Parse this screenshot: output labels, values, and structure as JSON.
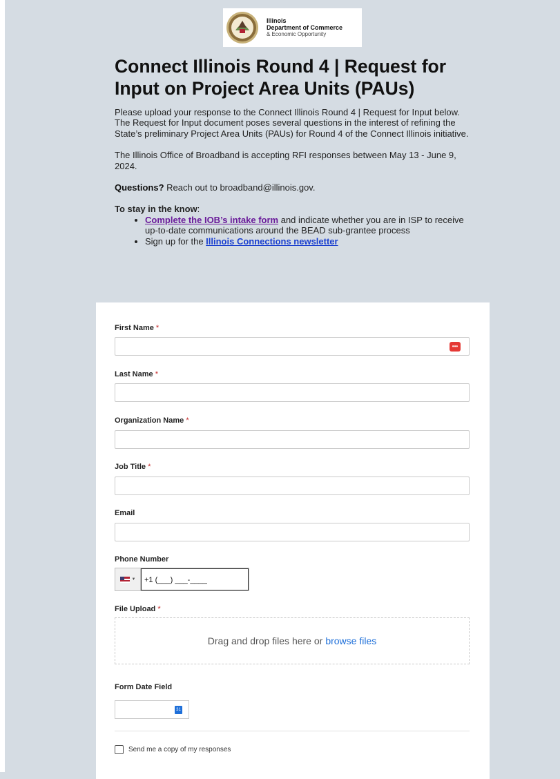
{
  "logo": {
    "line1": "Illinois",
    "line2": "Department of Commerce",
    "line3": "& Economic Opportunity"
  },
  "page": {
    "title": "Connect Illinois Round 4 | Request for Input on Project Area Units (PAUs)",
    "intro_p1": "Please upload your response to the Connect Illinois Round 4 | Request for Input below. The Request for Input document poses several questions in the interest of refining the State’s preliminary Project Area Units (PAUs) for Round 4 of the Connect Illinois initiative.",
    "intro_p2": "The Illinois Office of Broadband is accepting RFI responses between May 13 - June 9, 2024.",
    "questions_bold": "Questions?",
    "questions_text": " Reach out to broadband@illinois.gov.",
    "know_heading": "To stay in the know",
    "know_colon": ":",
    "bullet1_link": "Complete the IOB’s intake form",
    "bullet1_text": " and indicate whether you are in ISP to receive up-to-date communications around the BEAD sub-grantee process",
    "bullet2_text": "Sign up for the ",
    "bullet2_link": "Illinois Connections newsletter"
  },
  "form": {
    "required_mark": "*",
    "first_name_label": "First Name",
    "last_name_label": "Last Name",
    "organization_label": "Organization Name",
    "job_title_label": "Job Title",
    "email_label": "Email",
    "phone_label": "Phone Number",
    "phone_value": "+1 (___) ___-____",
    "file_upload_label": "File Upload",
    "drop_text": "Drag and drop files here or",
    "browse_link": "browse files",
    "date_label": "Form Date Field",
    "calendar_icon_text": "31",
    "copy_checkbox_label": "Send me a copy of my responses"
  },
  "icons": {
    "password_manager": "password-manager-icon",
    "flag": "us-flag-icon",
    "calendar": "calendar-icon"
  },
  "colors": {
    "background": "#d5dce3",
    "required": "#c62828",
    "link_visited": "#6a1b9a",
    "link": "#1a3fcf",
    "browse_link": "#1e6fd9"
  }
}
